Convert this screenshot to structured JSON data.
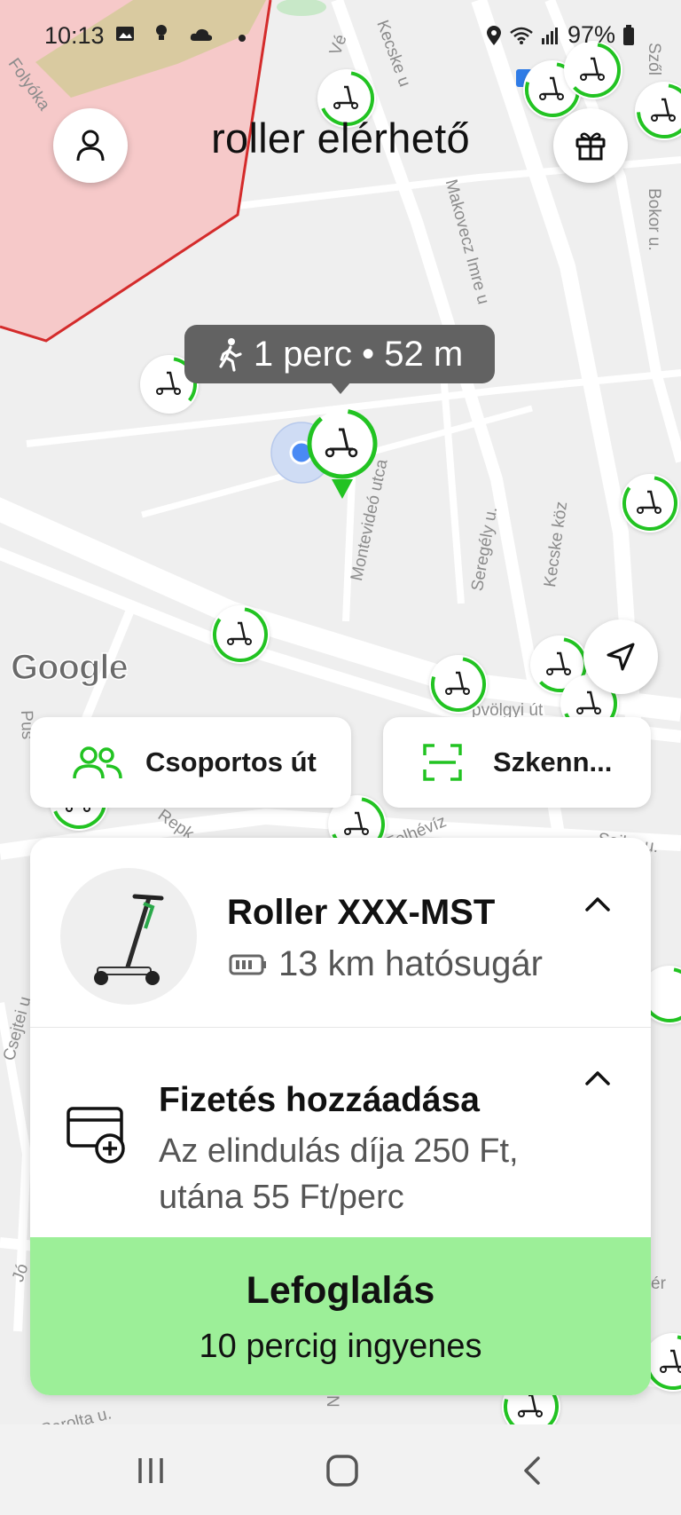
{
  "status_bar": {
    "time": "10:13",
    "battery": "97%",
    "left_icons": [
      "image-icon",
      "lightbulb-icon",
      "cloud-icon",
      "dot-icon"
    ],
    "right_icons": [
      "location-icon",
      "wifi-icon",
      "signal-icon",
      "battery-icon"
    ]
  },
  "header": {
    "title": "roller elérhető",
    "profile_icon": "person-icon",
    "gift_icon": "gift-icon"
  },
  "map": {
    "walk_tooltip": {
      "icon": "walking-icon",
      "text": "1 perc • 52 m"
    },
    "attribution": "Google",
    "street_labels": [
      "Folyóka",
      "Vé",
      "Kecske u",
      "Makovecz Imre u",
      "Bokor u.",
      "Szől",
      "Montevideó utca",
      "Seregély u.",
      "Kecske köz",
      "Pus",
      "Repk",
      "Felhévíz",
      "Sajka u.",
      "pvölgyi út",
      "Csejtei u",
      "Jó",
      "ér",
      "Sarolta u.",
      "N"
    ],
    "colors": {
      "accent_green": "#22c322",
      "restricted_zone_fill": "#f4c6c6",
      "restricted_zone_border": "#d42b2b",
      "user_location": "#4a8af4"
    },
    "recenter_icon": "navigation-arrow-icon"
  },
  "actions": {
    "group_ride_label": "Csoportos út",
    "group_ride_icon": "group-icon",
    "scan_label": "Szkenn...",
    "scan_icon": "scan-frame-icon"
  },
  "vehicle_card": {
    "name": "Roller XXX-MST",
    "range": "13 km hatósugár",
    "battery_icon": "battery-icon",
    "image": "scooter-image",
    "expand_icon": "chevron-up-icon"
  },
  "payment": {
    "title": "Fizetés hozzáadása",
    "description": "Az elindulás díja 250 Ft, utána 55 Ft/perc",
    "icon": "add-card-icon",
    "expand_icon": "chevron-up-icon"
  },
  "reserve": {
    "title": "Lefoglalás",
    "subtitle": "10 percig ingyenes",
    "color": "#9cef98"
  },
  "navbar": {
    "items": [
      "recents-icon",
      "home-icon",
      "back-icon"
    ]
  }
}
